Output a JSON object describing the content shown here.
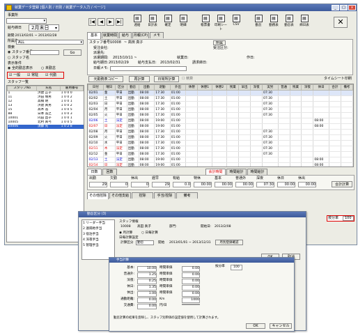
{
  "window": {
    "title": "就業データ登録   [個人別 / 日別 / 就業データ入力 / ページ]"
  },
  "left": {
    "office_label": "事業所",
    "office_value": "",
    "pay_label": "給与締日",
    "pay_value": "2月末日",
    "period": "期間:2013/02/01 ~ 2013/02/28",
    "dept_label": "所属先",
    "dept_value": "ALL",
    "search_label": "検索",
    "radio_staff_no": "スタッフ番号",
    "radio_staff_name": "スタッフ名",
    "go_button": "Go",
    "display_cond_label": "表示条件",
    "display_radio_1": "全的勤怠表示",
    "display_radio_2": "未勤怠",
    "check_general": "一般",
    "check_regular": "常駐",
    "check_dispatch": "代勤",
    "staff_list_label": "スタッフ一覧",
    "staff_headers": [
      "スタッフNo",
      "氏名",
      "雇用番号"
    ],
    "staff_rows": [
      [
        "1",
        "浜建 正子",
        "1 0 0 0"
      ],
      [
        "11",
        "浜田 増男",
        "1 0 0 2"
      ],
      [
        "12",
        "高橋 明",
        "1 0 0 1"
      ],
      [
        "13",
        "浜建 真男",
        "1 0 0 2"
      ],
      [
        "15",
        "高木 浩",
        "1 0 0 5"
      ],
      [
        "88",
        "日本 浩之",
        "1 0 0 3"
      ],
      [
        "10001",
        "内田 直子",
        "1 0 0 1"
      ],
      [
        "10005",
        "北村 真弓",
        "1 0 0 5"
      ],
      [
        "10006",
        "須藤 光",
        "1 0 2 8"
      ]
    ]
  },
  "toolbar": {
    "nav": [
      "|◀",
      "◀",
      "▶",
      "▶|"
    ],
    "icons": [
      {
        "icon": "form-icon",
        "label": "週給"
      },
      {
        "icon": "document-icon",
        "label": "日計表"
      },
      {
        "icon": "document-icon",
        "label": "確定"
      },
      {
        "icon": "document-icon",
        "label": "明細"
      },
      {
        "icon": "print-icon",
        "label": "帳票書"
      },
      {
        "icon": "print-icon",
        "label": "印刷シート"
      },
      {
        "icon": "save-icon",
        "label": "CSV"
      },
      {
        "icon": "form-icon",
        "label": "勤怠"
      },
      {
        "icon": "form-icon",
        "label": "勤務表"
      },
      {
        "icon": "form-icon",
        "label": "勤怠表"
      },
      {
        "icon": "form-icon",
        "label": "締日表"
      }
    ],
    "close_symbol": "✕"
  },
  "info": {
    "tabs": [
      "基本",
      "就業時間",
      "給与",
      "月報(CP)",
      "メモ"
    ],
    "staff_no_label": "スタッフ番号:",
    "staff_no_value": "10008",
    "staff_name": "~ 高田 真子",
    "dept_btn": "所属",
    "company_label": "受注会社:",
    "company_value": "",
    "job_label": "受注区分:",
    "workplace_label": "派遣先:",
    "dispatch_period_label": "派遣期間:",
    "dispatch_period_value": "2013/10/11 ~",
    "contract_label": "就業日:",
    "work_day_label": "作日:",
    "pay_period_label": "給与期日:",
    "pay_period_value": "2013/02/29",
    "bill_period_label": "給与支払日:",
    "bill_period_value": "2013/02/31",
    "invoice_label": "請求締日:",
    "memo_label": "日報メモ:"
  },
  "action_bar": {
    "copy_button": "元勤務表コピー",
    "recalc_button": "再計算",
    "fix_button": "日常所計算",
    "check_label": "精算",
    "timesheet_label": "タイムシート印刷"
  },
  "att_headers": [
    "日付",
    "曜日",
    "区分",
    "勤怠",
    "出勤",
    "退勤",
    "外出",
    "休憩",
    "休憩1",
    "休憩2",
    "残業",
    "早出",
    "深夜",
    "実労",
    "普通",
    "残業",
    "深夜",
    "休日",
    "合計",
    "備考"
  ],
  "att_rows": [
    {
      "d": "02/01",
      "w": "金",
      "c": "平日",
      "t": "出勤",
      "in": "08:00",
      "out": "17:30",
      "b": "01:00",
      "n": "",
      "wk": "07:30",
      "x": "",
      "type": "weekday"
    },
    {
      "d": "02/02",
      "w": "土",
      "c": "平日",
      "t": "出勤",
      "in": "08:00",
      "out": "17:30",
      "b": "01:00",
      "n": "",
      "wk": "07:30",
      "x": "",
      "type": "weekday"
    },
    {
      "d": "02/03",
      "w": "日",
      "c": "平日",
      "t": "出勤",
      "in": "08:00",
      "out": "17:30",
      "b": "01:00",
      "n": "",
      "wk": "07:30",
      "x": "",
      "type": "weekday"
    },
    {
      "d": "02/04",
      "w": "月",
      "c": "平日",
      "t": "出勤",
      "in": "08:00",
      "out": "17:30",
      "b": "01:00",
      "n": "",
      "wk": "07:30",
      "x": "",
      "type": "weekday"
    },
    {
      "d": "02/05",
      "w": "火",
      "c": "平日",
      "t": "出勤",
      "in": "08:00",
      "out": "17:30",
      "b": "01:00",
      "n": "",
      "wk": "07:30",
      "x": "",
      "type": "weekday"
    },
    {
      "d": "02/06",
      "w": "土",
      "c": "法定",
      "t": "出勤",
      "in": "08:00",
      "out": "19:00",
      "b": "01:00",
      "n": "",
      "wk": "",
      "x": "08:00",
      "type": "sat"
    },
    {
      "d": "02/07",
      "w": "日",
      "c": "法定",
      "t": "出勤",
      "in": "08:00",
      "out": "19:00",
      "b": "01:00",
      "n": "",
      "wk": "",
      "x": "08:00",
      "type": "sun"
    },
    {
      "d": "02/08",
      "w": "月",
      "c": "平日",
      "t": "出勤",
      "in": "08:00",
      "out": "17:30",
      "b": "01:00",
      "n": "",
      "wk": "07:30",
      "x": "",
      "type": "weekday"
    },
    {
      "d": "02/09",
      "w": "火",
      "c": "平日",
      "t": "出勤",
      "in": "08:00",
      "out": "17:30",
      "b": "01:00",
      "n": "",
      "wk": "07:30",
      "x": "",
      "type": "weekday"
    },
    {
      "d": "02/10",
      "w": "水",
      "c": "平日",
      "t": "出勤",
      "in": "08:00",
      "out": "17:30",
      "b": "01:00",
      "n": "",
      "wk": "07:30",
      "x": "",
      "type": "weekday"
    },
    {
      "d": "02/11",
      "w": "木",
      "c": "法定",
      "t": "出勤",
      "in": "08:00",
      "out": "17:30",
      "b": "01:00",
      "n": "",
      "wk": "07:30",
      "x": "",
      "type": "sun"
    },
    {
      "d": "02/12",
      "w": "金",
      "c": "平日",
      "t": "出勤",
      "in": "08:00",
      "out": "17:30",
      "b": "01:00",
      "n": "",
      "wk": "07:30",
      "x": "",
      "type": "weekday"
    },
    {
      "d": "02/13",
      "w": "土",
      "c": "法定",
      "t": "出勤",
      "in": "08:00",
      "out": "19:00",
      "b": "01:00",
      "n": "",
      "wk": "",
      "x": "08:00",
      "type": "sat"
    },
    {
      "d": "02/14",
      "w": "日",
      "c": "法定",
      "t": "出勤",
      "in": "08:00",
      "out": "19:00",
      "b": "01:00",
      "n": "",
      "wk": "",
      "x": "08:00",
      "type": "sun"
    },
    {
      "d": "02/15",
      "w": "月",
      "c": "平日",
      "t": "出勤",
      "in": "08:00",
      "out": "17:30",
      "b": "01:00",
      "n": "",
      "wk": "07:30",
      "x": "",
      "type": "weekday"
    }
  ],
  "summary": {
    "tabs": [
      "日数",
      "回数"
    ],
    "tabs2": [
      "会計時間",
      "時間給計",
      "時間給計"
    ],
    "headers": [
      "出勤",
      "欠勤",
      "休出",
      "遅早",
      "有給",
      "特休",
      "基本",
      "普通外",
      "深夜",
      "休日",
      "休出"
    ],
    "values": [
      "29",
      "0",
      "0",
      "29",
      "0.0",
      "00:00",
      "00:00",
      "00:00",
      "07:30",
      "00:00",
      "00:00"
    ],
    "totals_btn": "合計計算"
  },
  "bottom_tabs": [
    "その他控除",
    "その他支給",
    "控除",
    "手当/控除",
    "備考"
  ],
  "right_ratio": {
    "label": "按分率",
    "value": "100"
  },
  "dialog": {
    "title": "勤怠区分 (3)",
    "list": [
      "1 リーダー手当",
      "2 遠隔地手当",
      "3 宿泊手当",
      "4 深夜手当",
      "5 管理手当"
    ],
    "staff_label": "スタッフ情報",
    "staff_no": "10008",
    "staff_name": "高田 真子",
    "dept": "部門:",
    "sub_date": "開始日:",
    "sub_date_v": "2013/2/08",
    "radio_a": "月計算",
    "radio_b": "日毎計算",
    "section": "日毎計算設定",
    "calc_label": "計算区分",
    "calc_value": "勤怠",
    "start_label": "開始",
    "start_value": "2013/01/01 ~ 2013/12/31",
    "check_btn": "月別登録確認",
    "ok": "OK",
    "cancel": "取消"
  },
  "dialog2": {
    "title": "手当計算",
    "rows": [
      {
        "label": "基本:",
        "a": "10.00",
        "b": "時間単価",
        "c": "0.00"
      },
      {
        "label": "普通外:",
        "a": "1.25",
        "b": "時間単価",
        "c": "0.00"
      },
      {
        "label": "深夜:",
        "a": "0.25",
        "b": "時間単価",
        "c": "0.00"
      },
      {
        "label": "休日:",
        "a": "1.35",
        "b": "時間単価",
        "c": "0.00"
      },
      {
        "label": "休出:",
        "a": "1.00",
        "b": "時間単価",
        "c": "0.00"
      },
      {
        "label": "通勤距離:",
        "a": "0.00",
        "b": "Km",
        "c": "1000"
      },
      {
        "label": "交通費:",
        "a": "0.00",
        "b": "円/日",
        "c": ""
      }
    ],
    "rate_label": "按分率",
    "rate_value": "100",
    "note": "勤怠計算の結果を反映し、スタッフ別単価の設定値を使用して計算されます。",
    "ok": "OK",
    "cancel": "キャンセル"
  }
}
